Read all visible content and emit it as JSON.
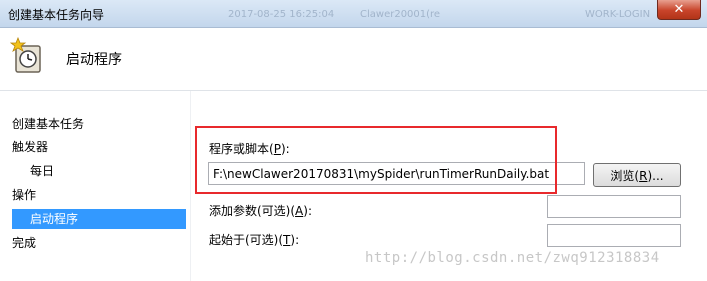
{
  "window": {
    "title": "创建基本任务向导",
    "close_glyph": "✕",
    "background_date": "2017-08-25 16:25:04",
    "background_user": "Clawer20001(re",
    "background_machine": "WORK-LOGIN"
  },
  "header": {
    "title": "启动程序",
    "icon": "clock-icon"
  },
  "sidebar": {
    "items": [
      {
        "label": "创建基本任务"
      },
      {
        "label": "触发器"
      },
      {
        "label": "每日"
      },
      {
        "label": "操作"
      },
      {
        "label": "启动程序",
        "selected": true
      },
      {
        "label": "完成"
      }
    ]
  },
  "form": {
    "program_label": "程序或脚本(",
    "program_mnemonic": "P",
    "program_label_end": "):",
    "program_value": "F:\\newClawer20170831\\mySpider\\runTimerRunDaily.bat",
    "browse_label": "浏览(",
    "browse_mnemonic": "R",
    "browse_label_end": ")...",
    "args_label": "添加参数(可选)(",
    "args_mnemonic": "A",
    "args_label_end": "):",
    "args_value": "",
    "start_label": "起始于(可选)(",
    "start_mnemonic": "T",
    "start_label_end": "):",
    "start_value": ""
  },
  "annotation": {
    "highlight_color": "#e8292c"
  },
  "watermark": {
    "text": "http://blog.csdn.net/zwq912318834"
  },
  "colors": {
    "selection": "#3399ff",
    "titlebar": "#c3d6ec"
  }
}
